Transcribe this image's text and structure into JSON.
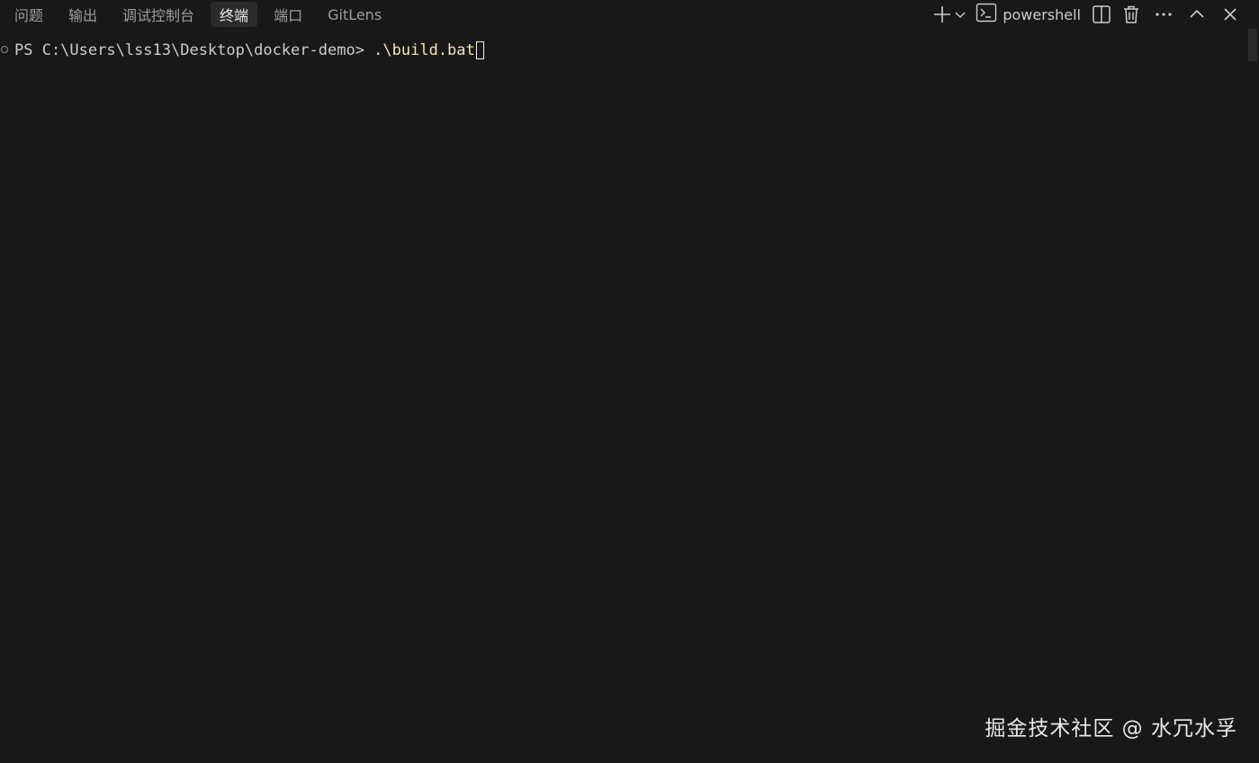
{
  "panel": {
    "tabs": [
      {
        "label": "问题",
        "active": false
      },
      {
        "label": "输出",
        "active": false
      },
      {
        "label": "调试控制台",
        "active": false
      },
      {
        "label": "终端",
        "active": true
      },
      {
        "label": "端口",
        "active": false
      },
      {
        "label": "GitLens",
        "active": false
      }
    ],
    "actions": {
      "new_terminal_icon": "plus-icon",
      "launch_profile_icon": "chevron-down-icon",
      "profile_icon": "terminal-icon",
      "profile_label": "powershell",
      "split_icon": "split-terminal-icon",
      "kill_icon": "trash-icon",
      "more_icon": "ellipsis-icon",
      "maximize_icon": "chevron-up-icon",
      "close_icon": "close-icon"
    }
  },
  "terminal": {
    "prompt": "PS C:\\Users\\lss13\\Desktop\\docker-demo> ",
    "command": ".\\build.bat",
    "prompt_color": "#cccccc",
    "command_color": "#f2e4b0"
  },
  "watermark": {
    "text": "掘金技术社区 @ 水冗水孚"
  },
  "colors": {
    "background": "#181818",
    "active_tab_bg": "#2b2b2b",
    "tab_text": "#9d9d9d",
    "active_tab_text": "#e7e7e7"
  }
}
